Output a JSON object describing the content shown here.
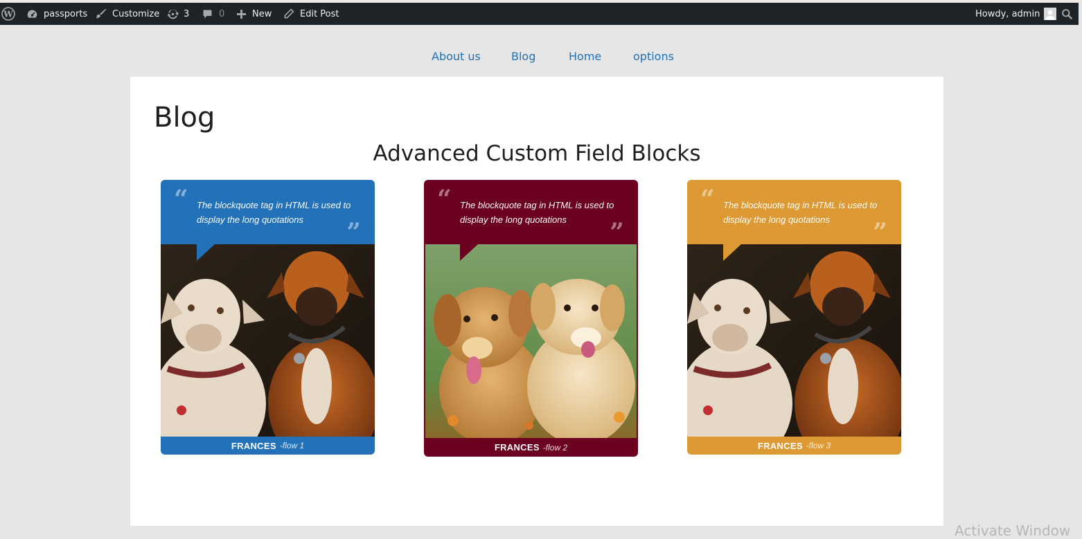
{
  "admin_bar": {
    "site_name": "passports",
    "customize": "Customize",
    "updates_count": "3",
    "comments_count": "0",
    "new_label": "New",
    "edit_post": "Edit Post",
    "howdy": "Howdy, admin"
  },
  "nav": {
    "items": [
      {
        "label": "About us"
      },
      {
        "label": "Blog"
      },
      {
        "label": "Home"
      },
      {
        "label": "options"
      }
    ]
  },
  "page": {
    "title": "Blog",
    "section_title": "Advanced Custom Field Blocks"
  },
  "cards": [
    {
      "quote": "The blockquote tag in HTML is used to display the long quotations",
      "name": "FRANCES",
      "flow": "-flow 1",
      "color": "#2271b9",
      "image": "two boxer dogs"
    },
    {
      "quote": "The blockquote tag in HTML is used to display the long quotations",
      "name": "FRANCES",
      "flow": "-flow 2",
      "color": "#6b0020",
      "image": "two golden retriever puppies"
    },
    {
      "quote": "The blockquote tag in HTML is used to display the long quotations",
      "name": "FRANCES",
      "flow": "-flow 3",
      "color": "#dd9933",
      "image": "two boxer dogs"
    }
  ],
  "watermark": "Activate Window"
}
